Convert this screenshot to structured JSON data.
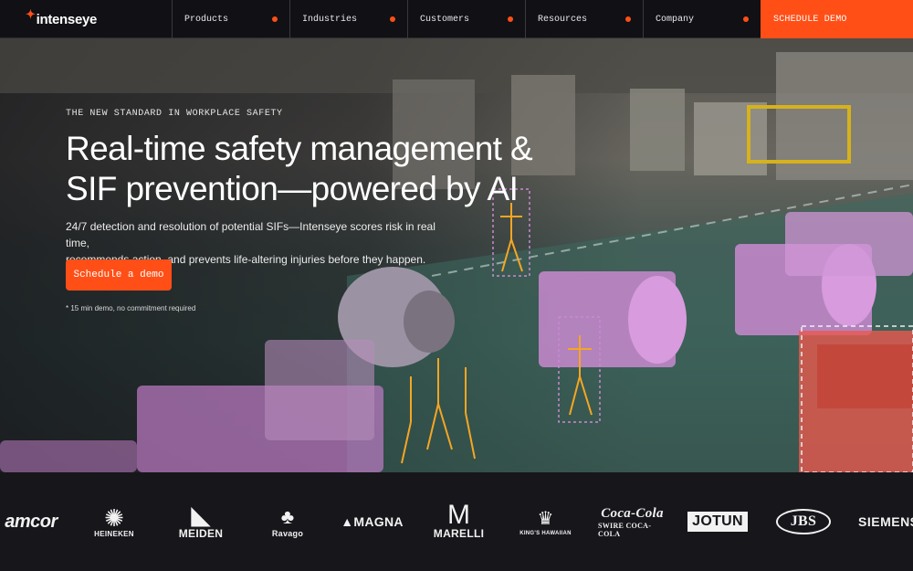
{
  "brand": {
    "name": "intenseye",
    "accent": "#ff4f17"
  },
  "nav": {
    "items": [
      {
        "label": "Products"
      },
      {
        "label": "Industries"
      },
      {
        "label": "Customers"
      },
      {
        "label": "Resources"
      },
      {
        "label": "Company"
      }
    ],
    "cta_label": "SCHEDULE DEMO"
  },
  "hero": {
    "eyebrow": "THE NEW STANDARD IN WORKPLACE SAFETY",
    "headline_line1": "Real-time safety management &",
    "headline_line2": "SIF prevention—powered by AI",
    "subtext_line1": "24/7 detection and resolution of potential SIFs—Intenseye scores risk in real time,",
    "subtext_line2": "recommends action, and prevents life-altering injuries before they happen.",
    "cta_label": "Schedule a demo",
    "footnote": "* 15 min demo, no commitment required"
  },
  "logos": [
    {
      "name": "amcor",
      "text": "amcor"
    },
    {
      "name": "heineken",
      "text": "HEINEKEN"
    },
    {
      "name": "meiden",
      "text": "MEIDEN"
    },
    {
      "name": "ravago",
      "text": "Ravago"
    },
    {
      "name": "magna",
      "text": "MAGNA"
    },
    {
      "name": "marelli",
      "text": "MARELLI"
    },
    {
      "name": "king-hawaiian",
      "text": "KING'S HAWAIIAN"
    },
    {
      "name": "swire-coca-cola",
      "text": "SWIRE COCA-COLA"
    },
    {
      "name": "jotun",
      "text": "JOTUN"
    },
    {
      "name": "jbs",
      "text": "JBS"
    },
    {
      "name": "siemens",
      "text": "SIEMENS"
    }
  ]
}
